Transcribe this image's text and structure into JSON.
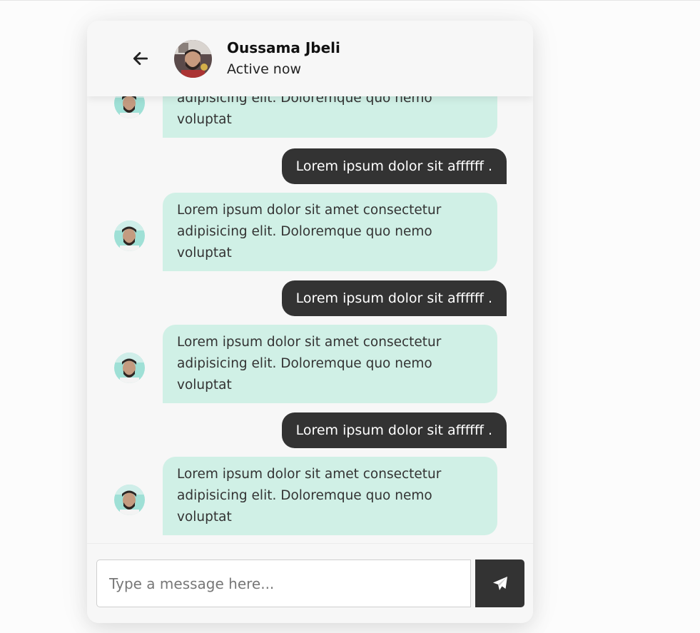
{
  "header": {
    "contact_name": "Oussama Jbeli",
    "status": "Active now"
  },
  "messages": [
    {
      "type": "incoming",
      "lines": [
        "adipisicing elit. Doloremque quo nemo",
        "voluptat"
      ]
    },
    {
      "type": "outgoing",
      "text": "Lorem ipsum dolor sit affffff ."
    },
    {
      "type": "incoming",
      "lines": [
        "Lorem ipsum dolor sit amet consectetur",
        "adipisicing elit. Doloremque quo nemo",
        "voluptat"
      ]
    },
    {
      "type": "outgoing",
      "text": "Lorem ipsum dolor sit affffff ."
    },
    {
      "type": "incoming",
      "lines": [
        "Lorem ipsum dolor sit amet consectetur",
        "adipisicing elit. Doloremque quo nemo",
        "voluptat"
      ]
    },
    {
      "type": "outgoing",
      "text": "Lorem ipsum dolor sit affffff ."
    },
    {
      "type": "incoming",
      "lines": [
        "Lorem ipsum dolor sit amet consectetur",
        "adipisicing elit. Doloremque quo nemo",
        "voluptat"
      ]
    }
  ],
  "composer": {
    "placeholder": "Type a message here..."
  },
  "colors": {
    "incoming_bubble": "#d0f0e6",
    "outgoing_bubble": "#333333",
    "send_button": "#333333"
  },
  "icons": {
    "back": "arrow-left-icon",
    "send": "paper-plane-icon"
  }
}
